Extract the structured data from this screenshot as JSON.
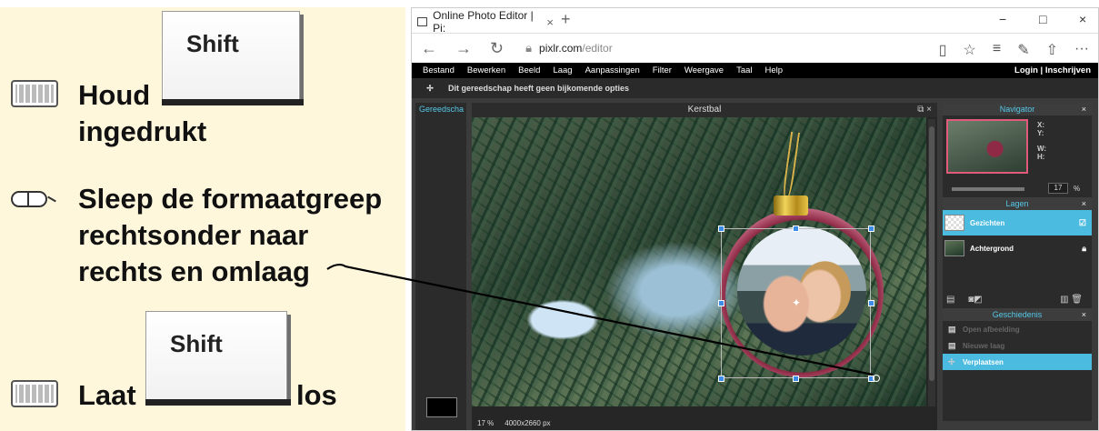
{
  "instructions": {
    "key_label_1": "Shift",
    "step1_word1": "Houd",
    "step1_word2": "ingedrukt",
    "step2_line1": "Sleep de formaatgreep",
    "step2_line2": "rechtsonder naar",
    "step2_line3": "rechts en omlaag",
    "key_label_2": "Shift",
    "step3_word1": "Laat",
    "step3_word2": "los"
  },
  "browser": {
    "tab_title": "Online Photo Editor | Pi:",
    "tab_close": "×",
    "new_tab": "+",
    "url_host": "pixlr.com",
    "url_path": "/editor",
    "win_min": "−",
    "win_max": "□",
    "win_close": "×",
    "nav_back": "←",
    "nav_forward": "→",
    "nav_refresh": "↻",
    "lock": "🔒︎",
    "reading": "▯",
    "star": "☆",
    "hub": "≡",
    "note": "✎",
    "share": "⇧",
    "more": "···"
  },
  "pixlr": {
    "menu": [
      "Bestand",
      "Bewerken",
      "Beeld",
      "Laag",
      "Aanpassingen",
      "Filter",
      "Weergave",
      "Taal",
      "Help"
    ],
    "login": "Login | Inschrijven",
    "options_text": "Dit gereedschap heeft geen bijkomende opties",
    "toolbox_title": "Gereedscha",
    "doc_title": "Kerstbal",
    "doc_controls": "⧉ ×",
    "status_zoom": "17",
    "status_pct": "%",
    "status_size": "4000x2660 px",
    "navigator": {
      "title": "Navigator",
      "close": "×",
      "x_label": "X:",
      "y_label": "Y:",
      "w_label": "W:",
      "h_label": "H:",
      "zoom_value": "17",
      "zoom_pct": "%"
    },
    "layers": {
      "title": "Lagen",
      "close": "×",
      "items": [
        {
          "name": "Gezichten",
          "flag": "☑"
        },
        {
          "name": "Achtergrond",
          "flag": "🔒︎"
        }
      ]
    },
    "history": {
      "title": "Geschiedenis",
      "close": "×",
      "items": [
        "Open afbeelding",
        "Nieuwe laag",
        "Verplaatsen"
      ]
    }
  },
  "colors": {
    "instruction_bg": "#fff7dc",
    "accent": "#4bbbe0",
    "handle": "#3d8be8"
  }
}
